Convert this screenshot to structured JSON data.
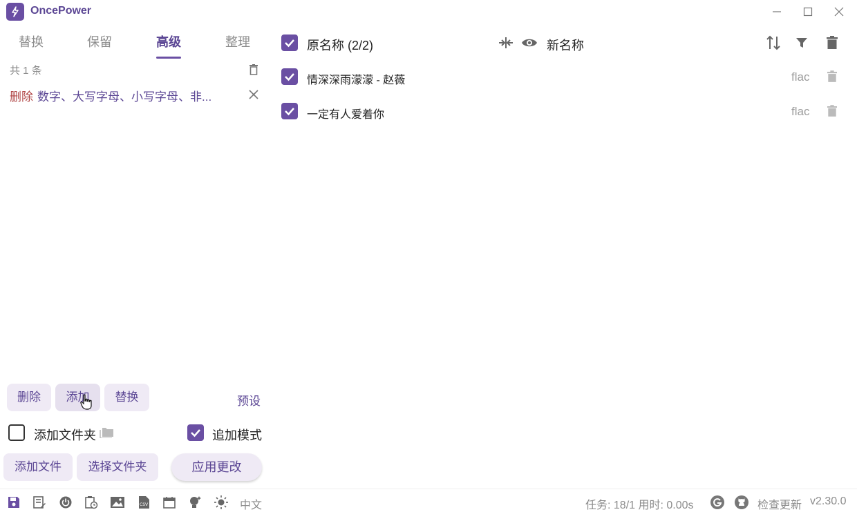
{
  "app": {
    "title": "OncePower"
  },
  "tabs": [
    {
      "label": "替换"
    },
    {
      "label": "保留"
    },
    {
      "label": "高级"
    },
    {
      "label": "整理"
    }
  ],
  "active_tab": "高级",
  "rules": {
    "count_label": "共 1 条",
    "items": [
      {
        "type": "删除",
        "description": "数字、大写字母、小写字母、非..."
      }
    ]
  },
  "actions": {
    "delete_label": "删除",
    "add_label": "添加",
    "replace_label": "替换",
    "preset_label": "预设"
  },
  "options": {
    "add_folder_label": "添加文件夹",
    "add_folder_checked": false,
    "append_mode_label": "追加模式",
    "append_mode_checked": true
  },
  "buttons": {
    "add_file": "添加文件",
    "select_folder": "选择文件夹",
    "apply": "应用更改"
  },
  "file_list": {
    "original_header": "原名称 (2/2)",
    "new_header": "新名称",
    "files": [
      {
        "name": "情深深雨濛濛 - 赵薇",
        "ext": "flac",
        "checked": true
      },
      {
        "name": "一定有人爱着你",
        "ext": "flac",
        "checked": true
      }
    ]
  },
  "statusbar": {
    "language": "中文",
    "task_label": "任务: 18/1 用时: 0.00s",
    "check_update": "检查更新",
    "version": "v2.30.0"
  },
  "colors": {
    "accent": "#6a4fa3",
    "accent_text": "#5b4694",
    "delete_red": "#b04545",
    "muted": "#8c8c8c",
    "pill_bg": "#efeaf5"
  }
}
